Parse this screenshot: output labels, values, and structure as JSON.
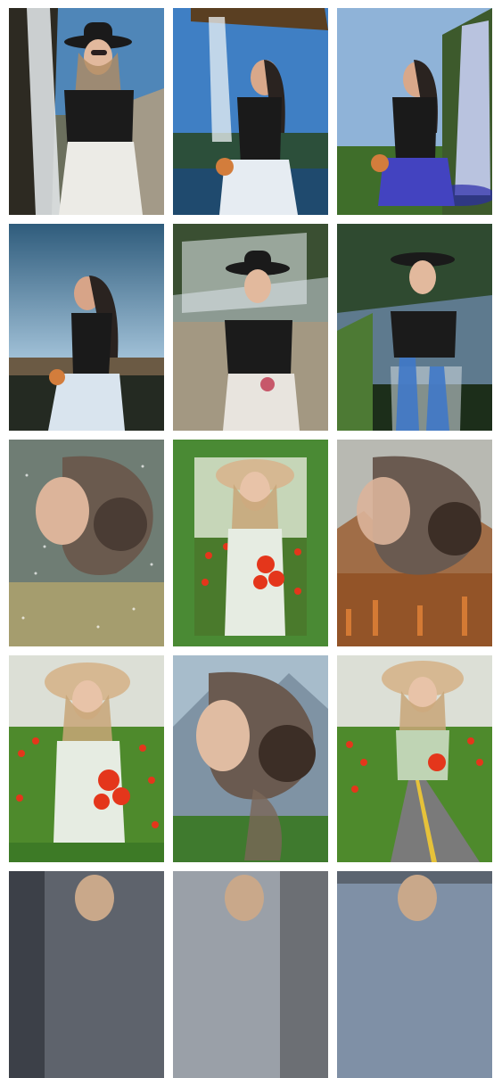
{
  "gallery": {
    "tiles": [
      {
        "theme": "waterfall-hat-portrait",
        "sky": "#5a8fb8",
        "ground": "#3d5a2e",
        "accent": "#e8e8e8"
      },
      {
        "theme": "waterfall-seated-lake",
        "sky": "#3f7fc4",
        "ground": "#2b5c3a",
        "accent": "#dfe6ee"
      },
      {
        "theme": "waterfall-seated-blue",
        "sky": "#8fb3d8",
        "ground": "#4c7a2f",
        "accent": "#9aa6ff"
      },
      {
        "theme": "sunset-seated-sea",
        "sky": "#6f9cc2",
        "ground": "#2f3b2c",
        "accent": "#b9d4ea"
      },
      {
        "theme": "waterfall-hat-double",
        "sky": "#7fa0b8",
        "ground": "#5b5447",
        "accent": "#d8d8d8"
      },
      {
        "theme": "falls-overlay-portrait",
        "sky": "#6d8aa6",
        "ground": "#2e4a2a",
        "accent": "#3f6db8"
      },
      {
        "theme": "glitter-profile-portrait",
        "sky": "#8c9a8a",
        "ground": "#4a4e3a",
        "accent": "#e9e1b8"
      },
      {
        "theme": "leaf-frame-poppies",
        "sky": "#b9c9a9",
        "ground": "#3f7a2e",
        "accent": "#e4361b"
      },
      {
        "theme": "autumn-forest-profile",
        "sky": "#b3b3ad",
        "ground": "#8a4a22",
        "accent": "#d47a34"
      },
      {
        "theme": "poppy-field-hat",
        "sky": "#d9dcd4",
        "ground": "#4e8a2c",
        "accent": "#e4361b"
      },
      {
        "theme": "mountain-profile-portrait",
        "sky": "#9fb6c4",
        "ground": "#3f7a2e",
        "accent": "#cfd8de"
      },
      {
        "theme": "road-poppy-hat",
        "sky": "#d9dcd4",
        "ground": "#4e8a2c",
        "accent": "#7a7a7a"
      },
      {
        "theme": "partial-row-1",
        "sky": "#6a6f78",
        "ground": "#55575c",
        "accent": "#c9a88a"
      },
      {
        "theme": "partial-row-2",
        "sky": "#9aa0a8",
        "ground": "#6c6f74",
        "accent": "#c9a88a"
      },
      {
        "theme": "partial-row-3",
        "sky": "#7f90a6",
        "ground": "#5b6470",
        "accent": "#c9a88a"
      }
    ]
  }
}
